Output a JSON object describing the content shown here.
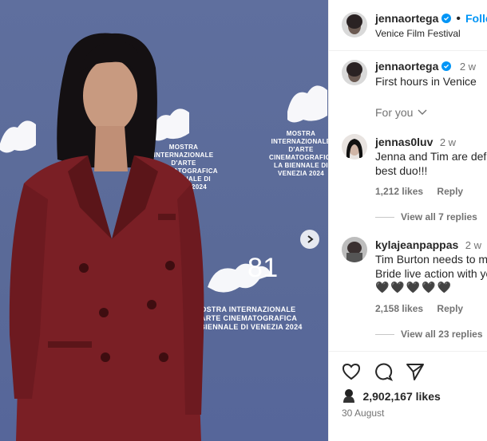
{
  "post": {
    "photo_alt": "jennaortega photo",
    "venice_logo": {
      "line1": "MOSTRA INTERNAZIONALE",
      "line2": "D'ARTE CINEMATOGRAFICA",
      "line3": "LA BIENNALE DI VENEZIA 2024",
      "number": "81"
    }
  },
  "header": {
    "username": "jennaortega",
    "separator": "•",
    "follow_label": "Follo",
    "location": "Venice Film Festival"
  },
  "caption": {
    "username": "jennaortega",
    "time": "2 w",
    "text": "First hours in Venice"
  },
  "for_you": {
    "label": "For you"
  },
  "comments": [
    {
      "username": "jennas0luv",
      "time": "2 w",
      "line1": "Jenna and Tim are defin",
      "line2": "best duo!!!",
      "likes": "1,212 likes",
      "reply": "Reply",
      "view_replies": "View all 7 replies"
    },
    {
      "username": "kylajeanpappas",
      "time": "2 w",
      "line1": "Tim Burton needs to m",
      "line2": "Bride live action with yo",
      "hearts": "🖤🖤🖤🖤🖤",
      "likes": "2,158 likes",
      "reply": "Reply",
      "view_replies": "View all 23 replies"
    }
  ],
  "footer": {
    "likes_count": "2,902,167 likes",
    "date": "30 August"
  },
  "colors": {
    "accent": "#0095f6",
    "backdrop": "#5c6c9c",
    "suit": "#7a1f25"
  }
}
